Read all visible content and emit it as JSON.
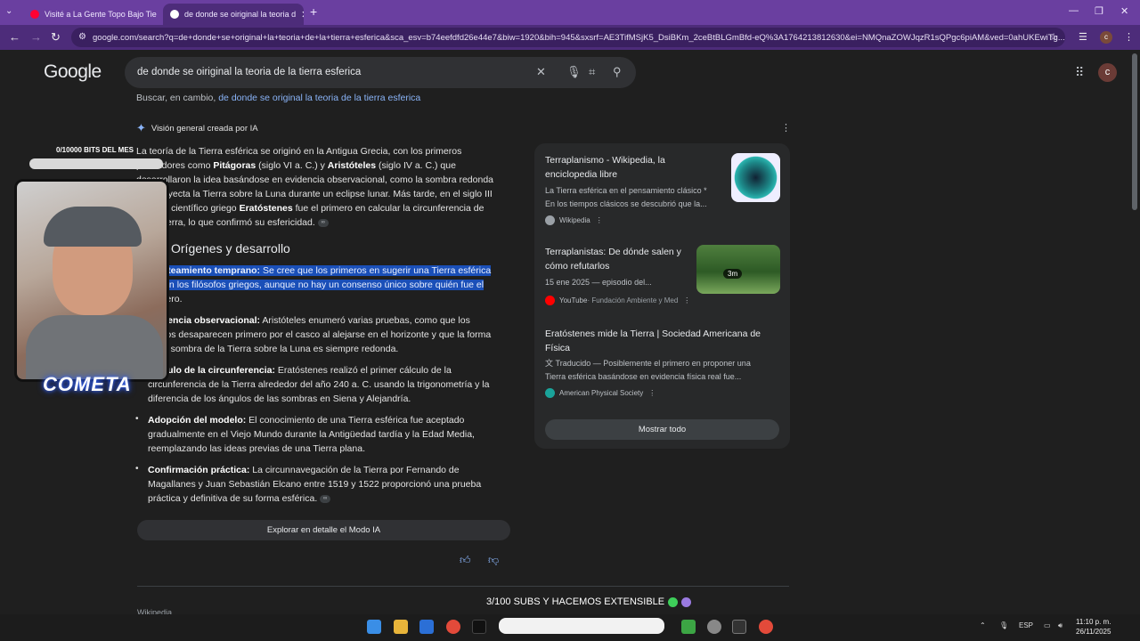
{
  "browser": {
    "tabs": [
      {
        "title": "Visité a La Gente Topo Bajo Tie",
        "active": false
      },
      {
        "title": "de donde se oiriginal la teoria d",
        "active": true
      }
    ],
    "url": "google.com/search?q=de+donde+se+original+la+teoria+de+la+tierra+esferica&sca_esv=b74eefdfd26e44e7&biw=1920&bih=945&sxsrf=AE3TifMSjK5_DsiBKm_2ceBtBLGmBfd-eQ%3A1764213812630&ei=NMQnaZOWJqzR1sQPgc6piAM&ved=0ahUKEwiTg...",
    "profile_initial": "c"
  },
  "google": {
    "logo": "Google",
    "query": "de donde se oiriginal la teoria de la tierra esferica",
    "alt_prefix": "Buscar, en cambio,",
    "alt_link": "de donde se original la teoria de la tierra esferica",
    "avatar_initial": "c"
  },
  "ai_overview": {
    "header": "Visión general creada por IA",
    "intro_lines": [
      "La teoría de la Tierra esférica se originó en la Antigua Grecia, con los primeros",
      "pensadores como ",
      "desarrollaron la idea basándose en evidencia observacional, como la sombra redonda",
      "que proyecta la Tierra sobre la Luna durante un eclipse lunar. Más tarde, en el siglo III",
      "a. C., el científico griego ",
      "de la Tierra, lo que confirmó su esfericidad."
    ],
    "pitagoras": "Pitágoras",
    "pitagoras_rest": " (siglo VI a. C.) y ",
    "aristoteles": "Aristóteles",
    "aristoteles_rest": " (siglo IV a. C.) que",
    "eratostenes": "Eratóstenes",
    "eratostenes_rest": " fue el primero en calcular la circunferencia de",
    "section_title": "Orígenes y desarrollo",
    "bullets": [
      {
        "bold": "Planteamiento temprano:",
        "lines": [
          " Se cree que los primeros en sugerir una Tierra esférica",
          "fueron los filósofos griegos, aunque no hay un consenso único sobre quién fue el",
          "primero."
        ]
      },
      {
        "bold": "Evidencia observacional:",
        "lines": [
          " Aristóteles enumeró varias pruebas, como que los",
          "barcos desaparecen primero por el casco al alejarse en el horizonte y que la forma",
          "de la sombra de la Tierra sobre la Luna es siempre redonda."
        ]
      },
      {
        "bold": "Cálculo de la circunferencia:",
        "lines": [
          " Eratóstenes realizó el primer cálculo de la",
          "circunferencia de la Tierra alrededor del año 240 a. C. usando la trigonometría y la",
          "diferencia de los ángulos de las sombras en Siena y Alejandría."
        ]
      },
      {
        "bold": "Adopción del modelo:",
        "lines": [
          " El conocimiento de una Tierra esférica fue aceptado",
          "gradualmente en el Viejo Mundo durante la Antigüedad tardía y la Edad Media,",
          "reemplazando las ideas previas de una Tierra plana."
        ]
      },
      {
        "bold": "Confirmación práctica:",
        "lines": [
          " La circunnavegación de la Tierra por Fernando de",
          "Magallanes y Juan Sebastián Elcano entre 1519 y 1522 proporcionó una prueba",
          "práctica y definitiva de su forma esférica."
        ]
      }
    ],
    "explore_button": "Explorar en detalle el Modo IA",
    "bottom_source": "Wikipedia"
  },
  "sources": [
    {
      "title": [
        "Terraplanismo - Wikipedia, la",
        "enciclopedia libre"
      ],
      "snippet": [
        "La Tierra esférica en el pensamiento clásico *",
        "En los tiempos clásicos se descubrió que la..."
      ],
      "source": "Wikipedia",
      "icon_color": "#9aa0a6"
    },
    {
      "title": [
        "Terraplanistas: De dónde salen y",
        "cómo refutarlos"
      ],
      "snippet": [
        "15 ene 2025 — episodio del..."
      ],
      "source": "YouTube",
      "source_extra": " · Fundación Ambiente y Med",
      "duration": "3m",
      "icon_color": "#ff0000"
    },
    {
      "title": [
        "Eratóstenes mide la Tierra | Sociedad Americana de",
        "Física"
      ],
      "snippet": [
        "Traducido — Posiblemente el primero en proponer una",
        "Tierra esférica basándose en evidencia física real fue..."
      ],
      "source": "American Physical Society",
      "icon_color": "#1aa39a"
    }
  ],
  "show_all": "Mostrar todo",
  "overlay": {
    "bits": "0/10000 BITS DEL MES",
    "logo": "COMETA",
    "subs": "3/100 SUBS Y HACEMOS EXTENSIBLE"
  },
  "taskbar": {
    "lang": "ESP",
    "time": "11:10 p. m.",
    "date": "26/11/2025"
  },
  "colors": {
    "tab_bar": "#6a3fa0",
    "toolbar": "#4d2c7a",
    "page_bg": "#1f1f1f",
    "link": "#8ab4f8",
    "highlight": "#1a4fb8"
  }
}
